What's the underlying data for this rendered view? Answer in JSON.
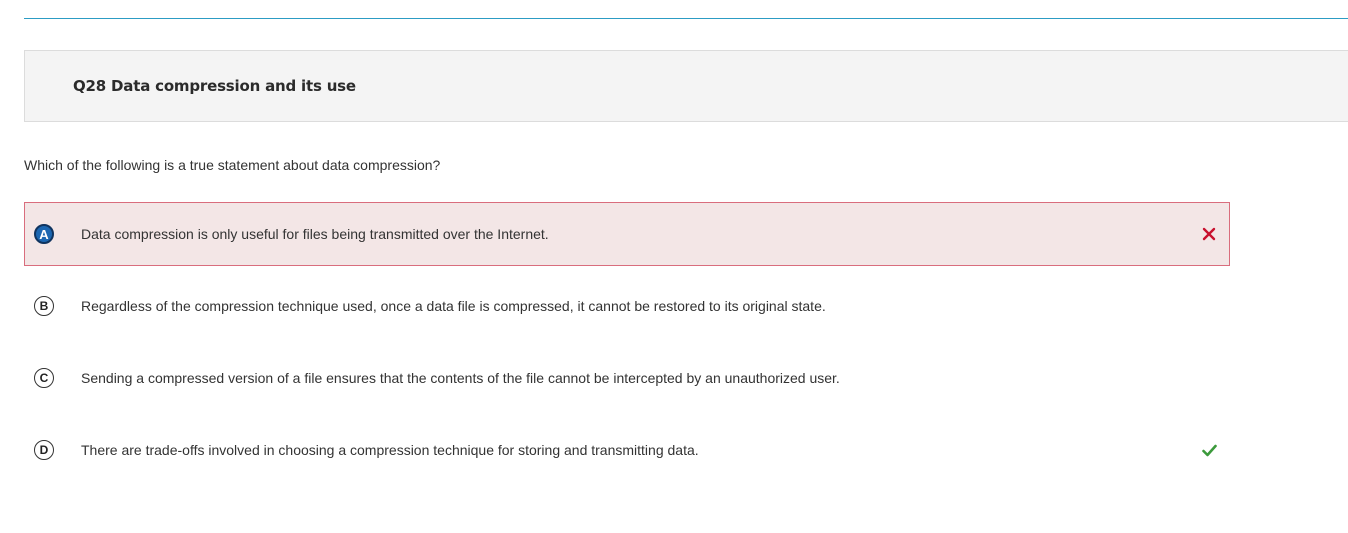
{
  "question": {
    "title": "Q28 Data compression and its use",
    "prompt": "Which of the following is a true statement about data compression?"
  },
  "choices": [
    {
      "letter": "A",
      "text": "Data compression is only useful for files being transmitted over the Internet.",
      "selected": true,
      "status": "incorrect"
    },
    {
      "letter": "B",
      "text": "Regardless of the compression technique used, once a data file is compressed, it cannot be restored to its original state.",
      "selected": false,
      "status": "none"
    },
    {
      "letter": "C",
      "text": "Sending a compressed version of a file ensures that the contents of the file cannot be intercepted by an unauthorized user.",
      "selected": false,
      "status": "none"
    },
    {
      "letter": "D",
      "text": "There are trade-offs involved in choosing a compression technique for storing and transmitting data.",
      "selected": false,
      "status": "correct"
    }
  ],
  "icons": {
    "incorrect": "close-icon",
    "correct": "checkmark-icon"
  },
  "colors": {
    "accent_rule": "#2c9cc4",
    "incorrect": "#c8102e",
    "correct": "#3c9a3c",
    "selected_fill": "#1b66b1"
  }
}
